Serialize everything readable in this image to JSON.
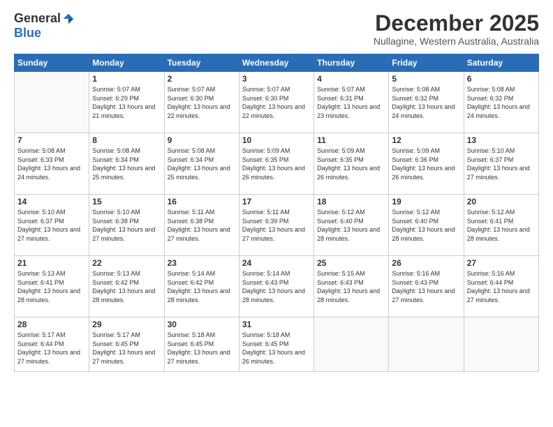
{
  "logo": {
    "general": "General",
    "blue": "Blue"
  },
  "header": {
    "month": "December 2025",
    "location": "Nullagine, Western Australia, Australia"
  },
  "days_of_week": [
    "Sunday",
    "Monday",
    "Tuesday",
    "Wednesday",
    "Thursday",
    "Friday",
    "Saturday"
  ],
  "weeks": [
    [
      {
        "day": "",
        "info": ""
      },
      {
        "day": "1",
        "info": "Sunrise: 5:07 AM\nSunset: 6:29 PM\nDaylight: 13 hours\nand 21 minutes."
      },
      {
        "day": "2",
        "info": "Sunrise: 5:07 AM\nSunset: 6:30 PM\nDaylight: 13 hours\nand 22 minutes."
      },
      {
        "day": "3",
        "info": "Sunrise: 5:07 AM\nSunset: 6:30 PM\nDaylight: 13 hours\nand 22 minutes."
      },
      {
        "day": "4",
        "info": "Sunrise: 5:07 AM\nSunset: 6:31 PM\nDaylight: 13 hours\nand 23 minutes."
      },
      {
        "day": "5",
        "info": "Sunrise: 5:08 AM\nSunset: 6:32 PM\nDaylight: 13 hours\nand 24 minutes."
      },
      {
        "day": "6",
        "info": "Sunrise: 5:08 AM\nSunset: 6:32 PM\nDaylight: 13 hours\nand 24 minutes."
      }
    ],
    [
      {
        "day": "7",
        "info": "Sunrise: 5:08 AM\nSunset: 6:33 PM\nDaylight: 13 hours\nand 24 minutes."
      },
      {
        "day": "8",
        "info": "Sunrise: 5:08 AM\nSunset: 6:34 PM\nDaylight: 13 hours\nand 25 minutes."
      },
      {
        "day": "9",
        "info": "Sunrise: 5:08 AM\nSunset: 6:34 PM\nDaylight: 13 hours\nand 25 minutes."
      },
      {
        "day": "10",
        "info": "Sunrise: 5:09 AM\nSunset: 6:35 PM\nDaylight: 13 hours\nand 26 minutes."
      },
      {
        "day": "11",
        "info": "Sunrise: 5:09 AM\nSunset: 6:35 PM\nDaylight: 13 hours\nand 26 minutes."
      },
      {
        "day": "12",
        "info": "Sunrise: 5:09 AM\nSunset: 6:36 PM\nDaylight: 13 hours\nand 26 minutes."
      },
      {
        "day": "13",
        "info": "Sunrise: 5:10 AM\nSunset: 6:37 PM\nDaylight: 13 hours\nand 27 minutes."
      }
    ],
    [
      {
        "day": "14",
        "info": "Sunrise: 5:10 AM\nSunset: 6:37 PM\nDaylight: 13 hours\nand 27 minutes."
      },
      {
        "day": "15",
        "info": "Sunrise: 5:10 AM\nSunset: 6:38 PM\nDaylight: 13 hours\nand 27 minutes."
      },
      {
        "day": "16",
        "info": "Sunrise: 5:11 AM\nSunset: 6:38 PM\nDaylight: 13 hours\nand 27 minutes."
      },
      {
        "day": "17",
        "info": "Sunrise: 5:11 AM\nSunset: 6:39 PM\nDaylight: 13 hours\nand 27 minutes."
      },
      {
        "day": "18",
        "info": "Sunrise: 5:12 AM\nSunset: 6:40 PM\nDaylight: 13 hours\nand 28 minutes."
      },
      {
        "day": "19",
        "info": "Sunrise: 5:12 AM\nSunset: 6:40 PM\nDaylight: 13 hours\nand 28 minutes."
      },
      {
        "day": "20",
        "info": "Sunrise: 5:12 AM\nSunset: 6:41 PM\nDaylight: 13 hours\nand 28 minutes."
      }
    ],
    [
      {
        "day": "21",
        "info": "Sunrise: 5:13 AM\nSunset: 6:41 PM\nDaylight: 13 hours\nand 28 minutes."
      },
      {
        "day": "22",
        "info": "Sunrise: 5:13 AM\nSunset: 6:42 PM\nDaylight: 13 hours\nand 28 minutes."
      },
      {
        "day": "23",
        "info": "Sunrise: 5:14 AM\nSunset: 6:42 PM\nDaylight: 13 hours\nand 28 minutes."
      },
      {
        "day": "24",
        "info": "Sunrise: 5:14 AM\nSunset: 6:43 PM\nDaylight: 13 hours\nand 28 minutes."
      },
      {
        "day": "25",
        "info": "Sunrise: 5:15 AM\nSunset: 6:43 PM\nDaylight: 13 hours\nand 28 minutes."
      },
      {
        "day": "26",
        "info": "Sunrise: 5:16 AM\nSunset: 6:43 PM\nDaylight: 13 hours\nand 27 minutes."
      },
      {
        "day": "27",
        "info": "Sunrise: 5:16 AM\nSunset: 6:44 PM\nDaylight: 13 hours\nand 27 minutes."
      }
    ],
    [
      {
        "day": "28",
        "info": "Sunrise: 5:17 AM\nSunset: 6:44 PM\nDaylight: 13 hours\nand 27 minutes."
      },
      {
        "day": "29",
        "info": "Sunrise: 5:17 AM\nSunset: 6:45 PM\nDaylight: 13 hours\nand 27 minutes."
      },
      {
        "day": "30",
        "info": "Sunrise: 5:18 AM\nSunset: 6:45 PM\nDaylight: 13 hours\nand 27 minutes."
      },
      {
        "day": "31",
        "info": "Sunrise: 5:18 AM\nSunset: 6:45 PM\nDaylight: 13 hours\nand 26 minutes."
      },
      {
        "day": "",
        "info": ""
      },
      {
        "day": "",
        "info": ""
      },
      {
        "day": "",
        "info": ""
      }
    ]
  ]
}
